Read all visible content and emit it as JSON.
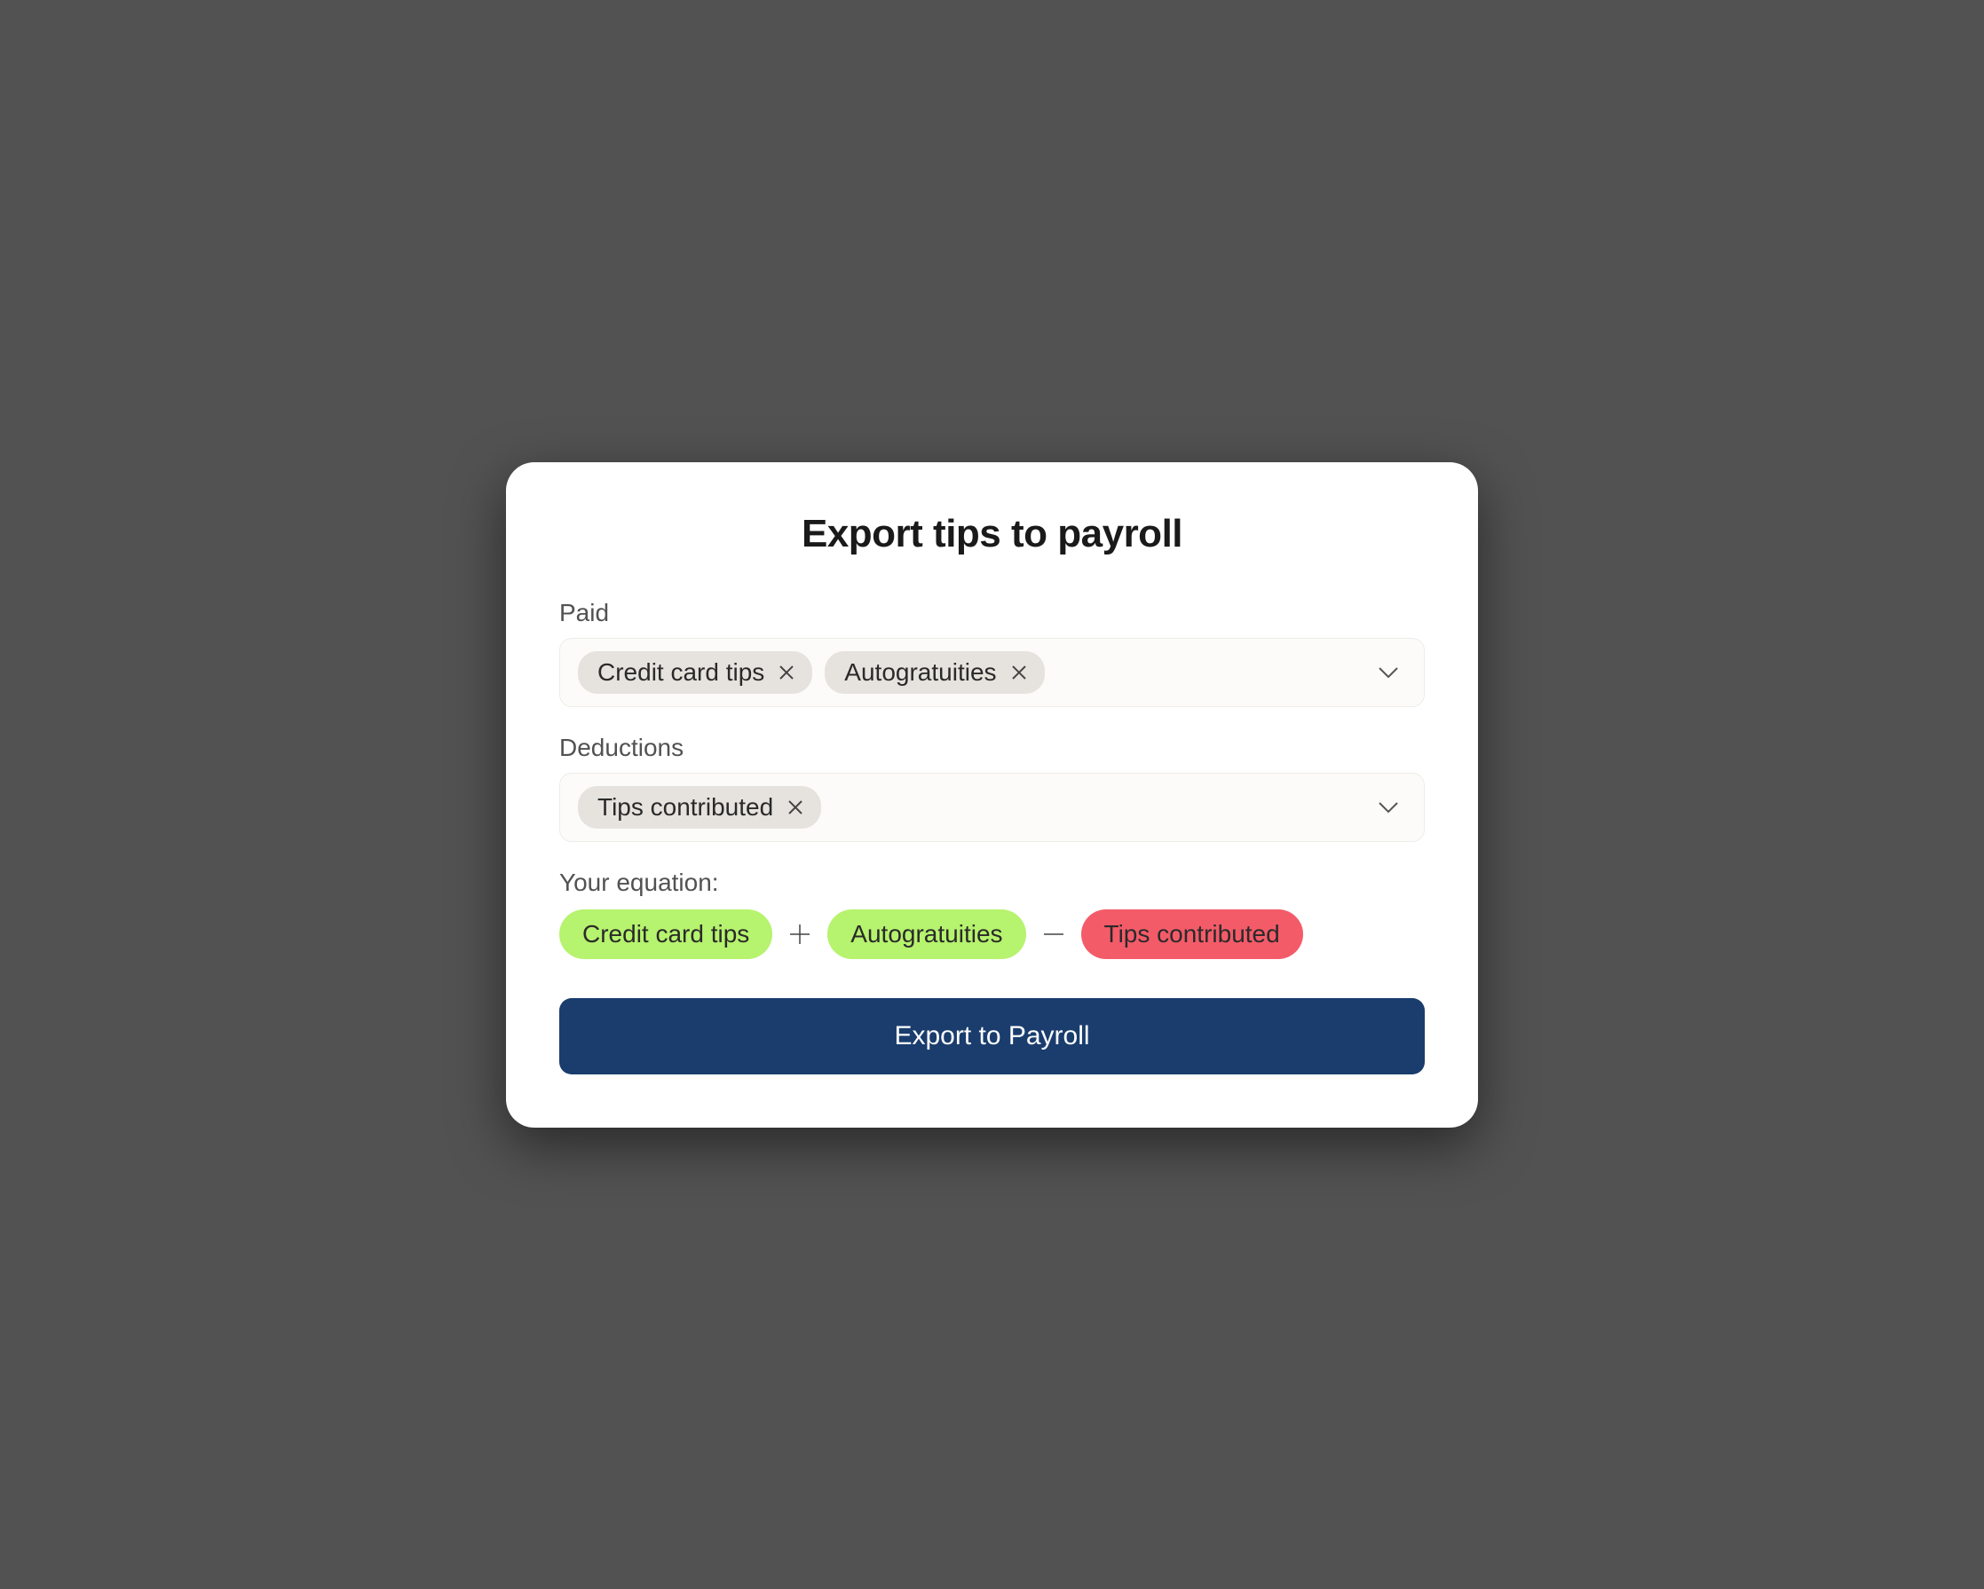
{
  "title": "Export tips to payroll",
  "paid": {
    "label": "Paid",
    "chips": [
      "Credit card tips",
      "Autogratuities"
    ]
  },
  "deductions": {
    "label": "Deductions",
    "chips": [
      "Tips contributed"
    ]
  },
  "equation": {
    "label": "Your equation:",
    "terms": [
      {
        "text": "Credit card tips",
        "color": "green"
      },
      {
        "op": "plus"
      },
      {
        "text": "Autogratuities",
        "color": "green"
      },
      {
        "op": "minus"
      },
      {
        "text": "Tips contributed",
        "color": "red"
      }
    ]
  },
  "exportButton": "Export to Payroll"
}
